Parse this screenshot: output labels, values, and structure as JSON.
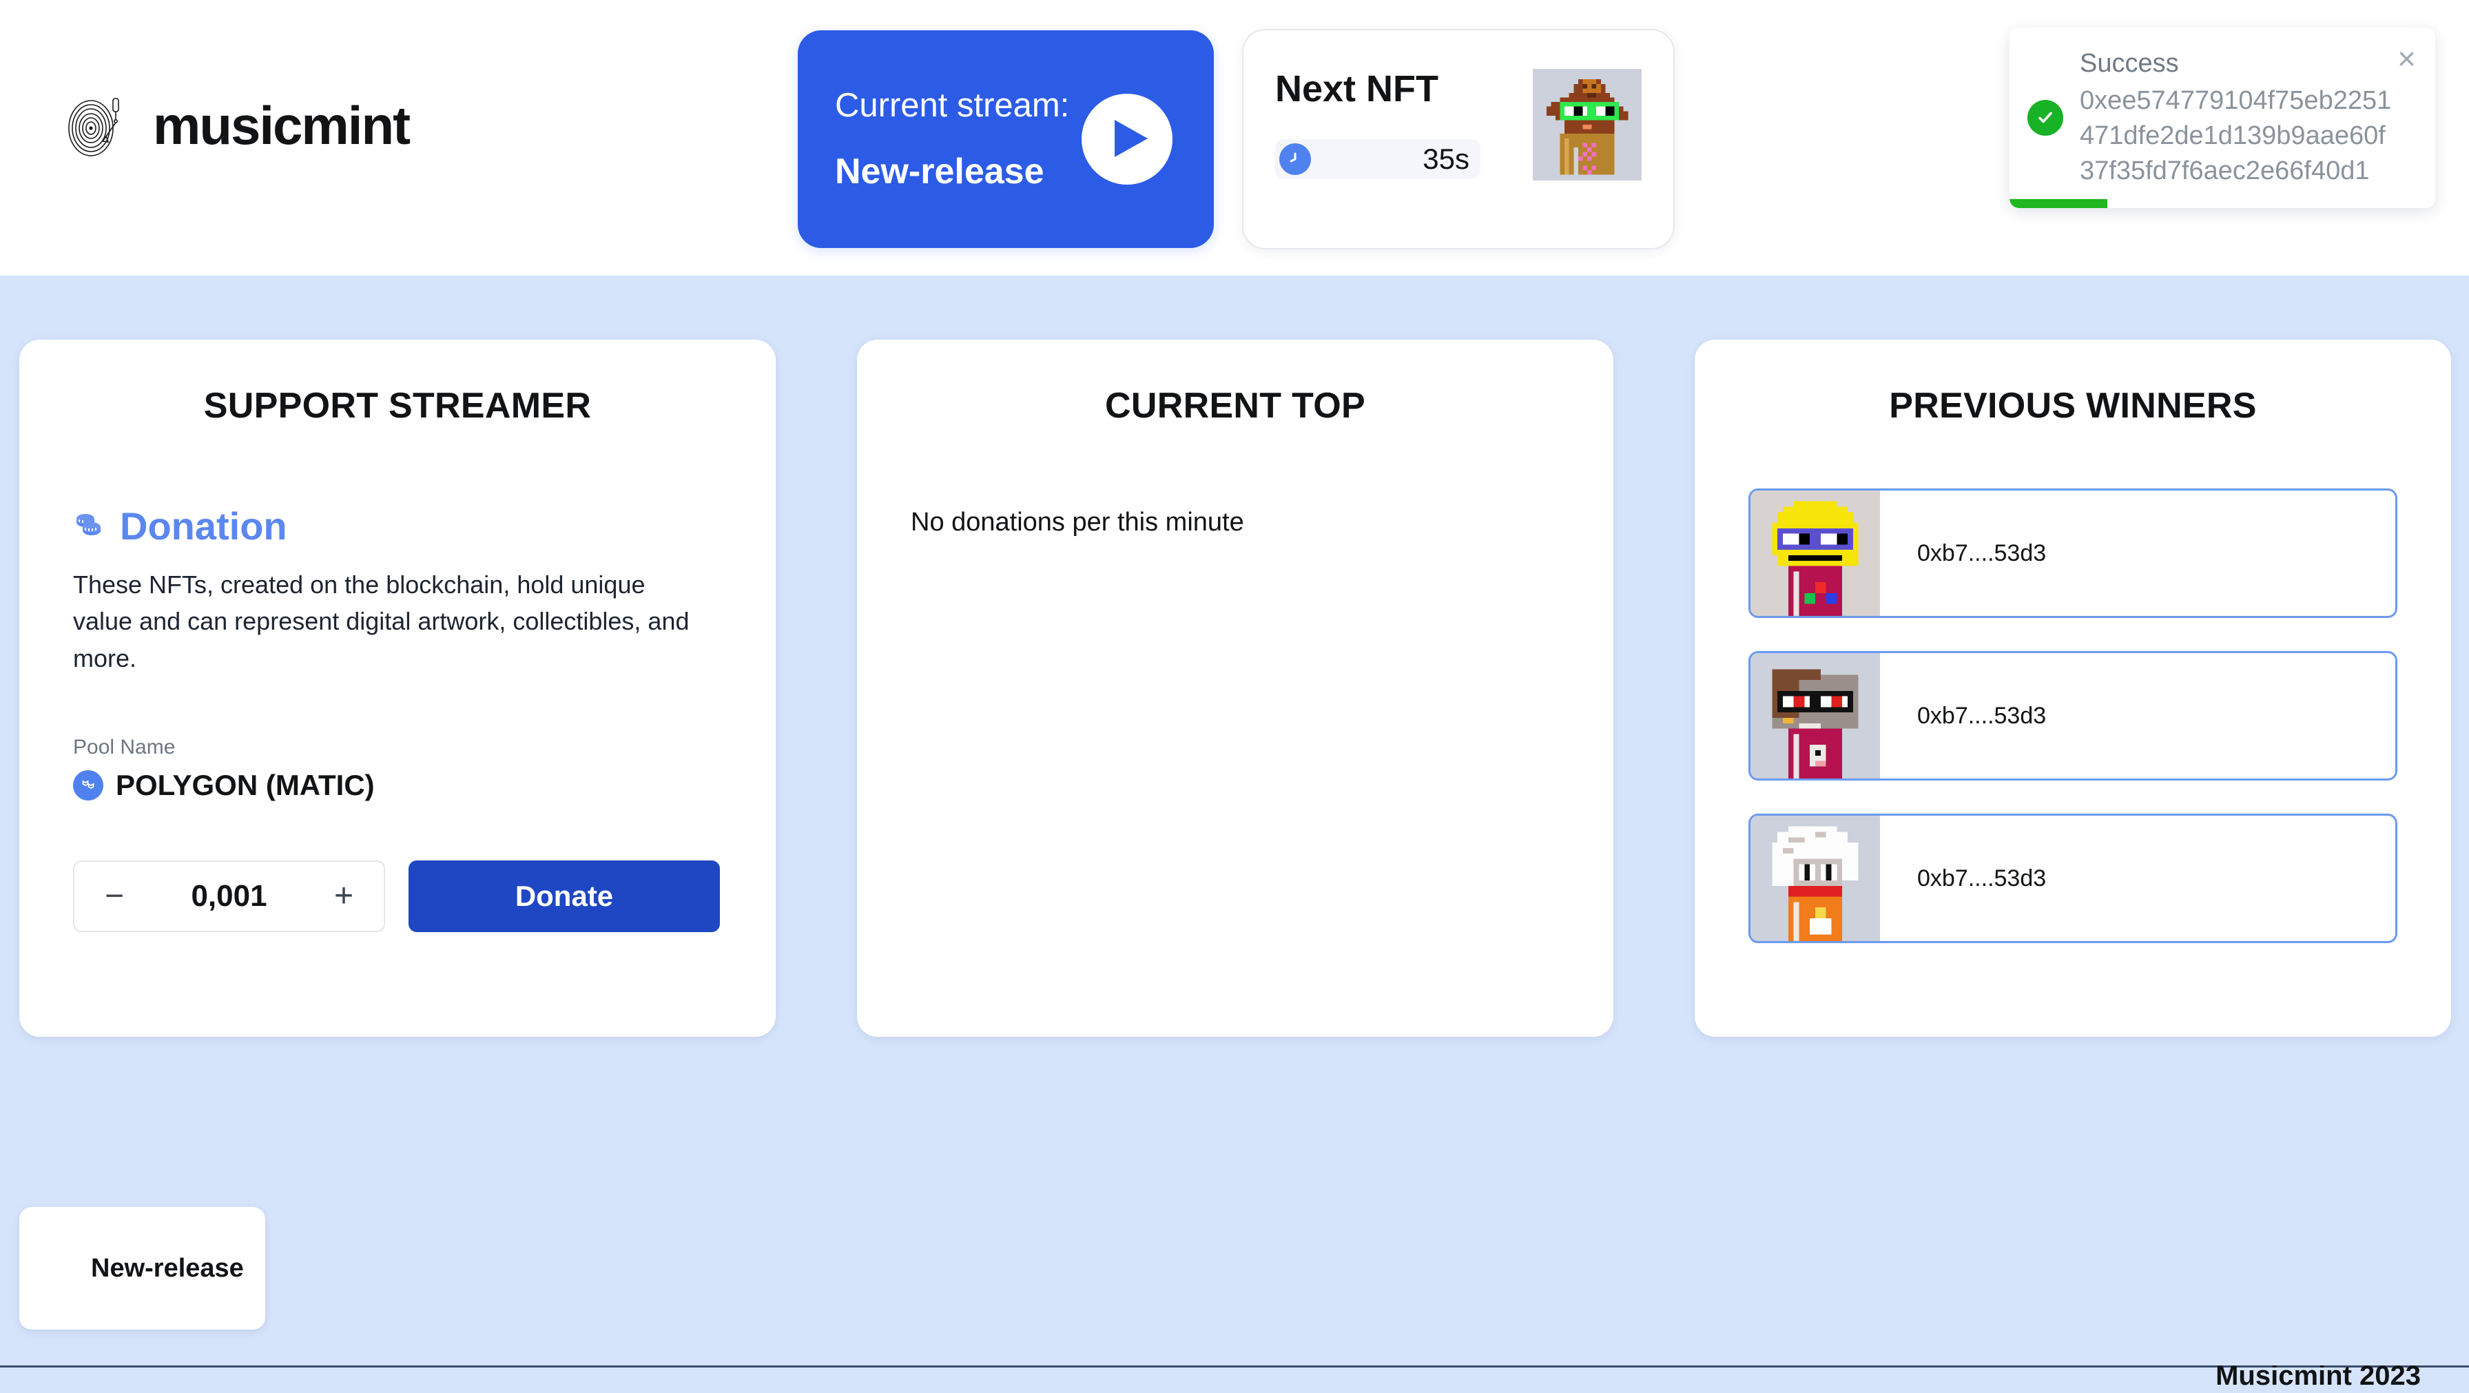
{
  "brand": {
    "name": "musicmint",
    "logo_icon": "vinyl-record-icon"
  },
  "stream_card": {
    "label": "Current stream:",
    "name": "New-release",
    "play_icon": "play-icon",
    "accent": "#2c5ce6"
  },
  "nft_card": {
    "title": "Next NFT",
    "timer": "35s",
    "progress_icon": "clock-icon",
    "thumb_name": "next-nft-thumbnail"
  },
  "toast": {
    "title": "Success",
    "hash": "0xee574779104f75eb2251471dfe2de1d139b9aae60f37f35fd7f6aec2e66f40d1",
    "close_label": "×",
    "status_color": "#17b225",
    "progress_percent": 23
  },
  "support_panel": {
    "title": "SUPPORT STREAMER",
    "donation_icon": "coins-icon",
    "donation_title": "Donation",
    "description": "These NFTs, created on the blockchain, hold unique value and can represent digital artwork, collectibles, and more.",
    "pool_label": "Pool Name",
    "pool_icon": "polygon-icon",
    "pool_value": "POLYGON (MATIC)",
    "decrement_label": "−",
    "amount": "0,001",
    "increment_label": "+",
    "donate_label": "Donate",
    "donate_color": "#1f47c4"
  },
  "current_top_panel": {
    "title": "CURRENT TOP",
    "empty_message": "No donations per this minute"
  },
  "winners_panel": {
    "title": "PREVIOUS WINNERS",
    "winners": [
      {
        "address": "0xb7....53d3",
        "thumb": "winner-nft-1"
      },
      {
        "address": "0xb7....53d3",
        "thumb": "winner-nft-2"
      },
      {
        "address": "0xb7....53d3",
        "thumb": "winner-nft-3"
      }
    ]
  },
  "release_chip": {
    "label": "New-release"
  },
  "footer": {
    "text": "Musicmint 2023"
  }
}
